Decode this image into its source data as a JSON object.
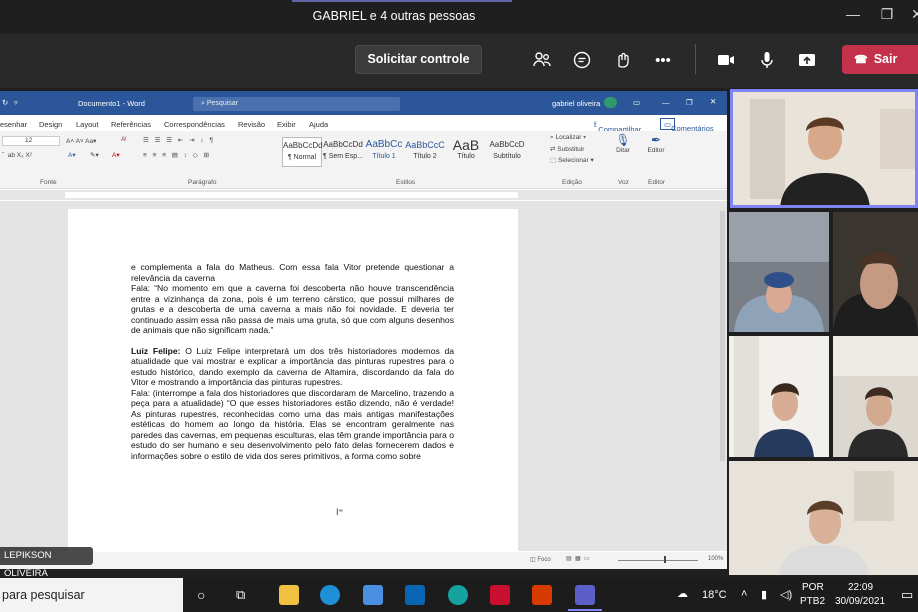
{
  "meeting": {
    "title": "GABRIEL e 4 outras pessoas",
    "request_control": "Solicitar controle",
    "leave": "Sair"
  },
  "word": {
    "doc_title": "Documento1  -  Word",
    "search_placeholder": "Pesquisar",
    "user": "gabriel oliveira",
    "tabs": [
      "esenhar",
      "Design",
      "Layout",
      "Referências",
      "Correspondências",
      "Revisão",
      "Exibir",
      "Ajuda"
    ],
    "share": "Compartilhar",
    "comments": "Comentários",
    "font_size": "12",
    "styles": [
      {
        "preview": "AaBbCcDd",
        "name": "¶ Normal"
      },
      {
        "preview": "AaBbCcDd",
        "name": "¶ Sem Esp..."
      },
      {
        "preview": "AaBbCc",
        "name": "Título 1"
      },
      {
        "preview": "AaBbCcC",
        "name": "Título 2"
      },
      {
        "preview": "AaB",
        "name": "Título"
      },
      {
        "preview": "AaBbCcD",
        "name": "Subtítulo"
      }
    ],
    "edit_items": [
      "Localizar",
      "Substituir",
      "Selecionar"
    ],
    "dictate": "Ditar",
    "editor": "Editor",
    "groups": {
      "font": "Fonte",
      "paragraph": "Parágrafo",
      "styles": "Estilos",
      "editing": "Edição",
      "voice": "Voz",
      "editor": "Editor"
    },
    "status_focus": "Foco",
    "zoom": "100%",
    "paragraphs": [
      "e complementa a fala do Matheus. Com essa fala Vitor pretende questionar a relevância da caverna",
      "Fala: “No momento em que a caverna foi descoberta não houve transcendência entre a vizinhança da zona, pois é um terreno cárstico, que possui milhares de grutas e a descoberta de uma caverna a mais não foi novidade. E deveria ter continuado assim essa não passa de mais uma gruta, só que com alguns desenhos de animais que não significam nada.”"
    ],
    "p2_bold": "Luiz Felipe:",
    "p2_text": " O Luiz Felipe interpretará um dos três historiadores modernos da atualidade que vai mostrar e explicar a importância das pinturas rupestres para o estudo histórico, dando exemplo da caverna de Altamira, discordando da fala do Vitor e mostrando a importância das pinturas rupestres.",
    "p3": "Fala: (interrompe a fala dos historiadores que discordaram de Marcelino, trazendo a peça para a atualidade) “O que esses historiadores estão dizendo, não é verdade! As pinturas rupestres, reconhecidas como uma das mais antigas manifestações estéticas do homem ao longo da história. Elas se encontram geralmente nas paredes das cavernas, em pequenas esculturas, elas têm grande importância para o estudo do ser humano e seu desenvolvimento pelo fato delas fornecerem dados e informações sobre o estilo de vida dos seres primitivos, a forma como sobre"
  },
  "presenter_name": "LEPIKSON OLIVEIRA",
  "taskbar": {
    "search": "para pesquisar",
    "temperature": "18°C",
    "lang1": "POR",
    "lang2": "PTB2",
    "time": "22:09",
    "date": "30/09/2021"
  }
}
